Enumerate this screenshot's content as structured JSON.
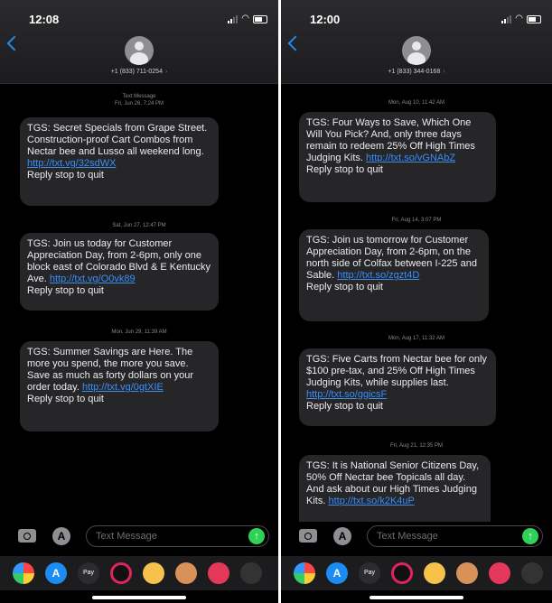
{
  "left": {
    "time": "12:08",
    "contact": "+1 (833) 711-0254",
    "thread_header": {
      "label": "Text Message",
      "date": "Fri, Jun 26, 7:24 PM"
    },
    "messages": [
      {
        "text": "TGS: Secret Specials from Grape Street. Construction-proof Cart Combos from Nectar bee and Lusso all weekend long.",
        "link": "http://txt.vg/32sdWX",
        "footer": "Reply stop to quit"
      },
      {
        "timestamp": "Sat, Jun 27, 12:47 PM",
        "text": "TGS: Join us today for Customer Appreciation Day, from 2-6pm, only one block east of Colorado Blvd & E Kentucky Ave.",
        "link": "http://txt.vg/O0vk89",
        "footer": "Reply stop to quit"
      },
      {
        "timestamp": "Mon, Jun 29, 11:39 AM",
        "text": "TGS: Summer Savings are Here. The more you spend, the more you save. Save as much as forty dollars on your order today.",
        "link": "http://txt.vg/0gtXIE",
        "footer": "Reply stop to quit"
      }
    ]
  },
  "right": {
    "time": "12:00",
    "contact": "+1 (833) 344-0168",
    "messages": [
      {
        "timestamp": "Mon, Aug 10, 11:42 AM",
        "text": "TGS: Four Ways to Save, Which One Will You Pick? And, only three days remain to redeem 25% Off High Times Judging Kits.",
        "link": "http://txt.so/vGNAbZ",
        "footer": "Reply stop to quit"
      },
      {
        "timestamp": "Fri, Aug 14, 3:07 PM",
        "text": "TGS: Join us tomorrow for Customer Appreciation Day, from 2-6pm, on the north side of Colfax between I-225 and Sable.",
        "link": "http://txt.so/zgzt4D",
        "footer": "Reply stop to quit"
      },
      {
        "timestamp": "Mon, Aug 17, 11:32 AM",
        "text": "TGS: Five Carts from Nectar bee for only $100 pre-tax, and 25% Off High Times Judging Kits, while supplies last.",
        "link": "http://txt.so/ggicsF",
        "footer": "Reply stop to quit"
      },
      {
        "timestamp": "Fri, Aug 21, 12:35 PM",
        "text": "TGS: It is National Senior Citizens Day, 50% Off Nectar bee Topicals all day. And ask about our High Times Judging Kits.",
        "link": "http://txt.so/k2K4uP",
        "footer": ""
      }
    ]
  },
  "composer": {
    "placeholder": "Text Message"
  },
  "apps": {
    "pay_label": "Pay",
    "store_glyph": "A"
  },
  "icons": [
    "camera-icon",
    "app-store-icon",
    "send-arrow-icon",
    "back-chevron-icon",
    "contact-avatar-icon",
    "signal-icon",
    "wifi-icon",
    "battery-icon"
  ],
  "colors": {
    "bubble": "#262628",
    "link": "#3a8ef5",
    "send": "#30d158",
    "back": "#1e8cf0"
  }
}
